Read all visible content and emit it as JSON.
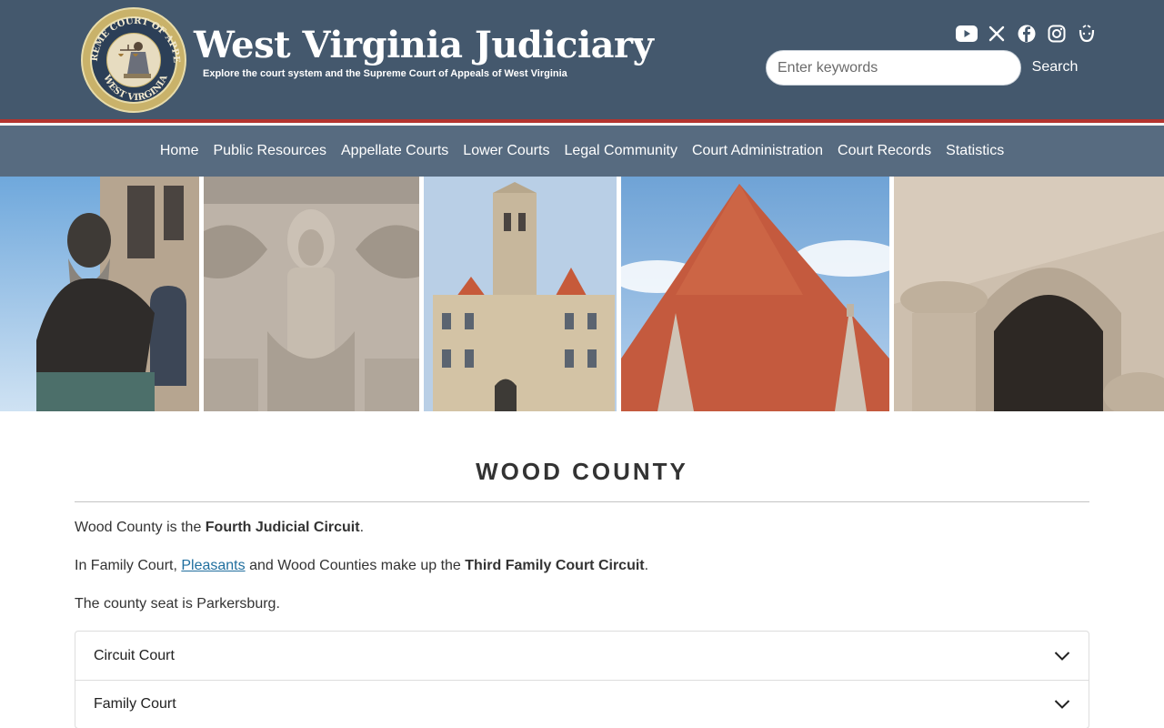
{
  "header": {
    "title": "West Virginia Judiciary",
    "tagline": "Explore the court system and the Supreme Court of Appeals of West Virginia",
    "seal_text_top": "SUPREME COURT OF APPEALS",
    "seal_text_bottom": "WEST VIRGINIA",
    "social_icons": [
      "youtube-icon",
      "x-icon",
      "facebook-icon",
      "instagram-icon",
      "threads-icon"
    ],
    "search": {
      "placeholder": "Enter keywords",
      "button_label": "Search"
    }
  },
  "nav": {
    "items": [
      "Home",
      "Public Resources",
      "Appellate Courts",
      "Lower Courts",
      "Legal Community",
      "Court Administration",
      "Court Records",
      "Statistics"
    ]
  },
  "main": {
    "title": "WOOD COUNTY",
    "p1": {
      "before": "Wood County is the ",
      "bold": "Fourth Judicial Circuit",
      "after": "."
    },
    "p2": {
      "before": "In Family Court, ",
      "link": "Pleasants",
      "middle": " and Wood Counties make up the ",
      "bold": "Third Family Court Circuit",
      "after": "."
    },
    "p3": "The county seat is Parkersburg.",
    "accordion": [
      "Circuit Court",
      "Family Court"
    ]
  },
  "colors": {
    "header_bg": "#44586d",
    "nav_bg": "#576b80",
    "accent_red": "#b4342e",
    "link": "#1f6e9e"
  }
}
